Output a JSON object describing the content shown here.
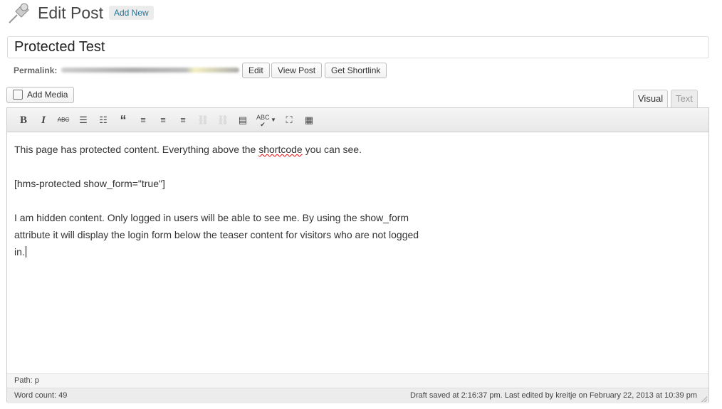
{
  "header": {
    "title": "Edit Post",
    "add_new": "Add New",
    "icon": "pushpin-icon"
  },
  "post": {
    "title": "Protected Test"
  },
  "permalink": {
    "label": "Permalink:",
    "edit": "Edit",
    "view_post": "View Post",
    "get_shortlink": "Get Shortlink"
  },
  "media": {
    "add_media": "Add Media"
  },
  "tabs": {
    "visual": "Visual",
    "text": "Text",
    "active": "Visual"
  },
  "toolbar": [
    "bold-icon",
    "italic-icon",
    "strikethrough-icon",
    "bullet-list-icon",
    "numbered-list-icon",
    "blockquote-icon",
    "align-left-icon",
    "align-center-icon",
    "align-right-icon",
    "link-icon",
    "unlink-icon",
    "more-tag-icon",
    "spellcheck-icon",
    "fullscreen-icon",
    "kitchen-sink-icon"
  ],
  "content": {
    "p1_a": "This page has protected content. Everything above the ",
    "p1_b": "shortcode",
    "p1_c": " you can see.",
    "p2": "[hms-protected show_form=\"true\"]",
    "p3": "I am hidden content. Only logged in users will be able to see me. By using the show_form attribute it will display the login form below the teaser content for visitors who are not logged in."
  },
  "status": {
    "path": "Path: p",
    "word_count": "Word count: 49",
    "draft": "Draft saved at 2:16:37 pm. Last edited by kreitje on February 22, 2013 at 10:39 pm"
  }
}
